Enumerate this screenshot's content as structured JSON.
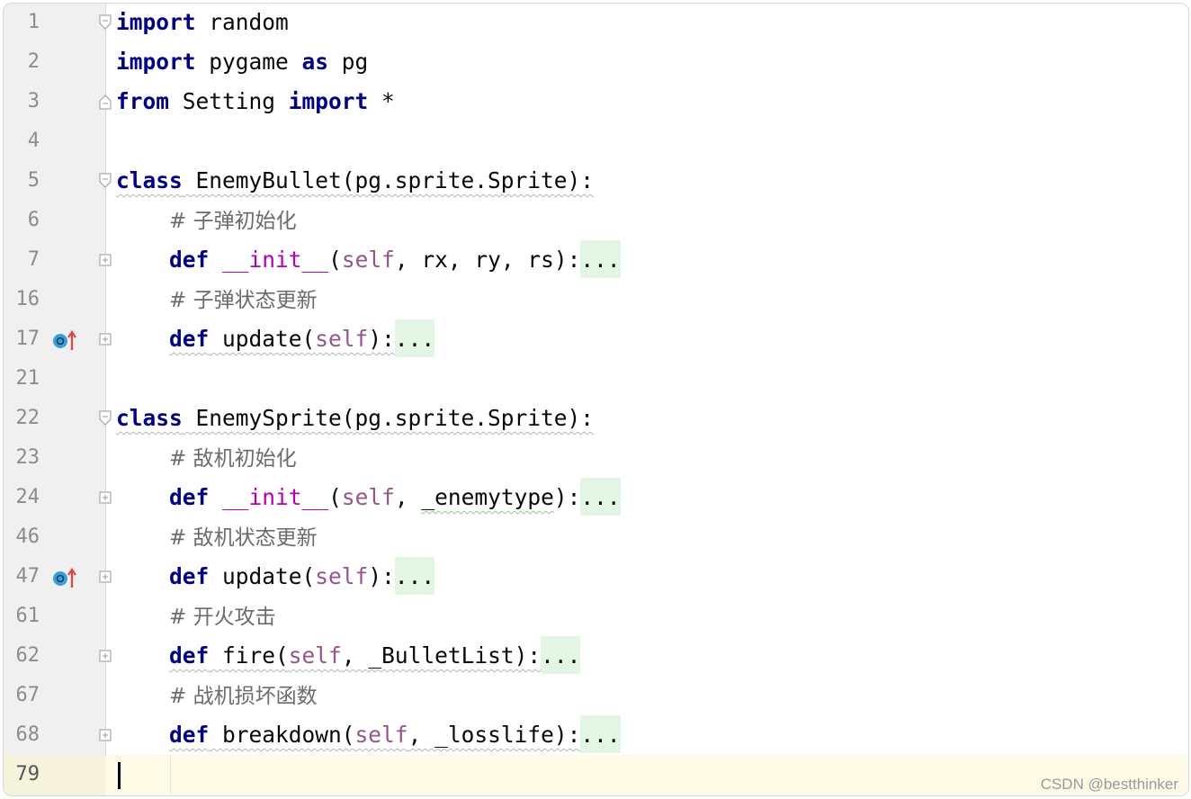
{
  "editor": {
    "lines": [
      {
        "num": "1",
        "fold": "open",
        "marker": false,
        "tokens": [
          [
            "kw2",
            "import"
          ],
          [
            "plain",
            " random"
          ]
        ]
      },
      {
        "num": "2",
        "fold": "",
        "marker": false,
        "tokens": [
          [
            "kw2",
            "import"
          ],
          [
            "plain",
            " pygame "
          ],
          [
            "kw2",
            "as"
          ],
          [
            "plain",
            " pg"
          ]
        ]
      },
      {
        "num": "3",
        "fold": "close",
        "marker": false,
        "tokens": [
          [
            "kw2",
            "from"
          ],
          [
            "plain",
            " Setting "
          ],
          [
            "kw2",
            "import"
          ],
          [
            "plain",
            " *"
          ]
        ]
      },
      {
        "num": "4",
        "fold": "",
        "marker": false,
        "tokens": []
      },
      {
        "num": "5",
        "fold": "open",
        "marker": false,
        "tokens": [
          [
            "kw2-wavy",
            "class"
          ],
          [
            "plain-wavy",
            " EnemyBullet(pg.sprite.Sprite):"
          ]
        ]
      },
      {
        "num": "6",
        "fold": "",
        "marker": false,
        "tokens": [
          [
            "plain",
            "    "
          ],
          [
            "comment",
            "# 子弹初始化"
          ]
        ]
      },
      {
        "num": "7",
        "fold": "plus",
        "marker": false,
        "tokens": [
          [
            "plain",
            "    "
          ],
          [
            "kw2",
            "def"
          ],
          [
            "plain",
            " "
          ],
          [
            "dunder",
            "__init__"
          ],
          [
            "plain",
            "("
          ],
          [
            "selfc",
            "self"
          ],
          [
            "plain",
            ", rx, ry, rs):"
          ],
          [
            "folded",
            "..."
          ]
        ]
      },
      {
        "num": "16",
        "fold": "",
        "marker": false,
        "tokens": [
          [
            "plain",
            "    "
          ],
          [
            "comment",
            "# 子弹状态更新"
          ]
        ]
      },
      {
        "num": "17",
        "fold": "plus",
        "marker": true,
        "tokens": [
          [
            "plain",
            "    "
          ],
          [
            "kw2-wavy",
            "def"
          ],
          [
            "plain-wavy",
            " update("
          ],
          [
            "selfc-wavy",
            "self"
          ],
          [
            "plain-wavy",
            "):"
          ],
          [
            "folded",
            "..."
          ]
        ]
      },
      {
        "num": "21",
        "fold": "",
        "marker": false,
        "tokens": []
      },
      {
        "num": "22",
        "fold": "open",
        "marker": false,
        "tokens": [
          [
            "kw2-wavy",
            "class"
          ],
          [
            "plain-wavy",
            " EnemySprite(pg.sprite.Sprite):"
          ]
        ]
      },
      {
        "num": "23",
        "fold": "",
        "marker": false,
        "tokens": [
          [
            "plain",
            "    "
          ],
          [
            "comment",
            "# 敌机初始化"
          ]
        ]
      },
      {
        "num": "24",
        "fold": "plus",
        "marker": false,
        "tokens": [
          [
            "plain",
            "    "
          ],
          [
            "kw2",
            "def"
          ],
          [
            "plain",
            " "
          ],
          [
            "dunder",
            "__init__"
          ],
          [
            "plain",
            "("
          ],
          [
            "selfc",
            "self"
          ],
          [
            "plain",
            ", "
          ],
          [
            "plain-wavygreen",
            "_enemytype"
          ],
          [
            "plain",
            "):"
          ],
          [
            "folded",
            "..."
          ]
        ]
      },
      {
        "num": "46",
        "fold": "",
        "marker": false,
        "tokens": [
          [
            "plain",
            "    "
          ],
          [
            "comment",
            "# 敌机状态更新"
          ]
        ]
      },
      {
        "num": "47",
        "fold": "plus",
        "marker": true,
        "tokens": [
          [
            "plain",
            "    "
          ],
          [
            "kw2",
            "def"
          ],
          [
            "plain",
            " update("
          ],
          [
            "selfc",
            "self"
          ],
          [
            "plain",
            "):"
          ],
          [
            "folded",
            "..."
          ]
        ]
      },
      {
        "num": "61",
        "fold": "",
        "marker": false,
        "tokens": [
          [
            "plain",
            "    "
          ],
          [
            "comment",
            "# 开火攻击"
          ]
        ]
      },
      {
        "num": "62",
        "fold": "plus",
        "marker": false,
        "tokens": [
          [
            "plain",
            "    "
          ],
          [
            "kw2-wavy",
            "def"
          ],
          [
            "plain-wavy",
            " fire("
          ],
          [
            "selfc-wavy",
            "self"
          ],
          [
            "plain-wavy",
            ", _BulletList):"
          ],
          [
            "folded",
            "..."
          ]
        ]
      },
      {
        "num": "67",
        "fold": "",
        "marker": false,
        "tokens": [
          [
            "plain",
            "    "
          ],
          [
            "comment",
            "# 战机损坏函数"
          ]
        ]
      },
      {
        "num": "68",
        "fold": "plus",
        "marker": false,
        "tokens": [
          [
            "plain",
            "    "
          ],
          [
            "kw2-wavy",
            "def"
          ],
          [
            "plain-wavy",
            " breakdown("
          ],
          [
            "selfc-wavy",
            "self"
          ],
          [
            "plain-wavy",
            ", _losslife):"
          ],
          [
            "folded",
            "..."
          ]
        ]
      },
      {
        "num": "79",
        "fold": "",
        "marker": false,
        "current": true,
        "tokens": []
      }
    ]
  },
  "watermark": "CSDN @bestthinker",
  "colors": {
    "keyword": "#000080",
    "dunder": "#b200b2",
    "self": "#94558d",
    "comment": "#6b6b6b",
    "folded_bg": "#e3f6e3",
    "current_line_bg": "#fdfbe6",
    "gutter_bg": "#f0f0f0"
  },
  "icons": {
    "override_marker": "override-method-icon"
  }
}
